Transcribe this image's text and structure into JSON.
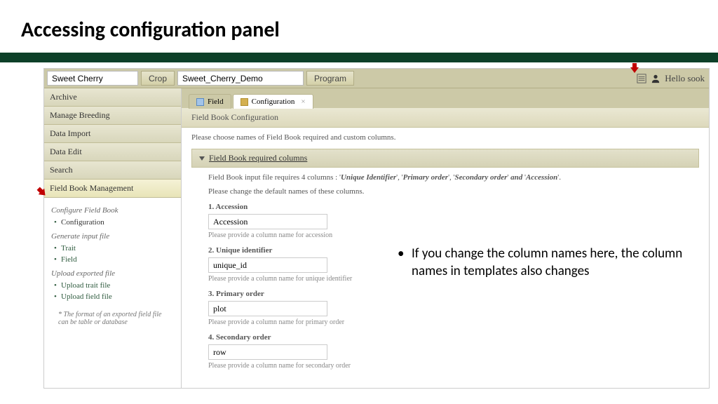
{
  "slide": {
    "title": "Accessing configuration panel"
  },
  "topbar": {
    "crop_value": "Sweet Cherry",
    "crop_btn": "Crop",
    "program_value": "Sweet_Cherry_Demo",
    "program_btn": "Program",
    "greeting": "Hello sook"
  },
  "sidebar": {
    "items": [
      "Archive",
      "Manage Breeding",
      "Data Import",
      "Data Edit",
      "Search",
      "Field Book Management"
    ],
    "groups": [
      {
        "title": "Configure Field Book",
        "links": [
          "Configuration"
        ]
      },
      {
        "title": "Generate input file",
        "links": [
          "Trait",
          "Field"
        ]
      },
      {
        "title": "Upload exported file",
        "links": [
          "Upload trait file",
          "Upload field file"
        ]
      }
    ],
    "note": "* The format of an exported field file can be table or database"
  },
  "tabs": {
    "field": "Field",
    "config": "Configuration"
  },
  "panel": {
    "header": "Field Book Configuration",
    "intro": "Please choose names of Field Book required and custom columns.",
    "accordion": "Field Book required columns",
    "req_prefix": "Field Book input file requires 4 columns : ",
    "req_c1": "Unique Identifier",
    "req_c2": "Primary order",
    "req_c3": "Secondary order",
    "req_c4": "Accession",
    "req_and": " and ",
    "change_note": "Please change the default names of these columns.",
    "fields": [
      {
        "label": "1. Accession",
        "value": "Accession",
        "help": "Please provide a column name for accession"
      },
      {
        "label": "2. Unique identifier",
        "value": "unique_id",
        "help": "Please provide a column name for unique identifier"
      },
      {
        "label": "3. Primary order",
        "value": "plot",
        "help": "Please provide a column name for primary order"
      },
      {
        "label": "4. Secondary order",
        "value": "row",
        "help": "Please provide a column name for secondary order"
      }
    ]
  },
  "callout": "If you change the column names here, the column names in templates also changes"
}
